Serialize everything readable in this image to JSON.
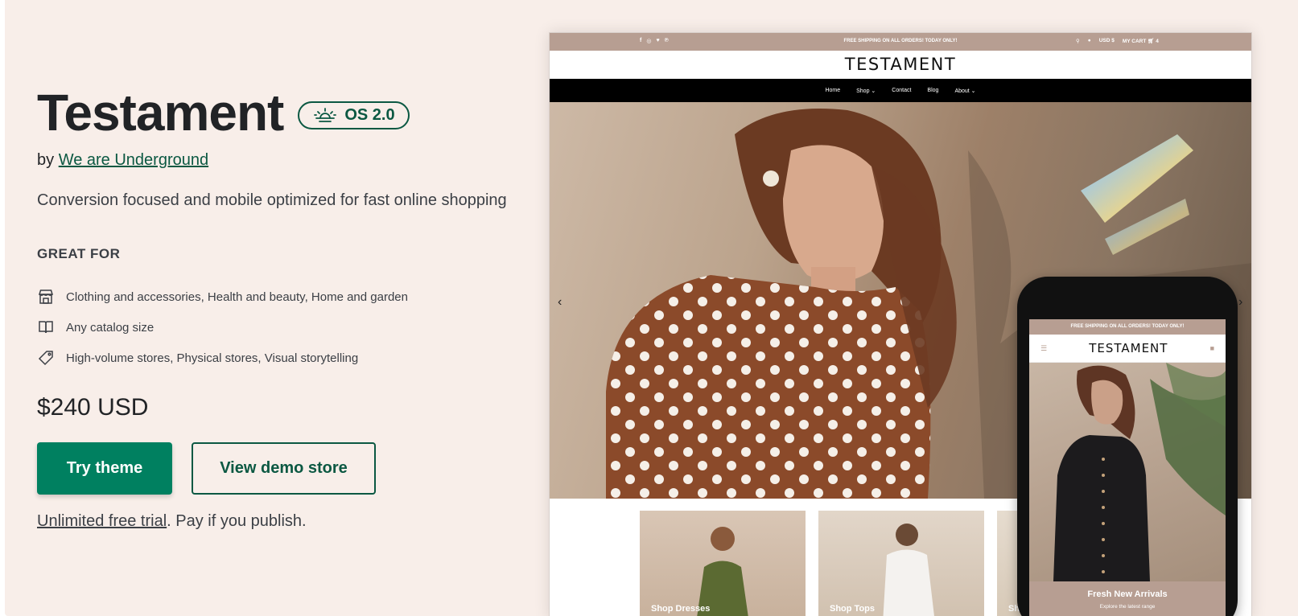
{
  "theme": {
    "name": "Testament",
    "badge": "OS 2.0",
    "by_prefix": "by",
    "author": "We are Underground",
    "tagline": "Conversion focused and mobile optimized for fast online shopping"
  },
  "great_for": {
    "heading": "GREAT FOR",
    "items": [
      {
        "icon": "storefront-icon",
        "label": "Clothing and accessories, Health and beauty, Home and garden"
      },
      {
        "icon": "book-icon",
        "label": "Any catalog size"
      },
      {
        "icon": "tag-icon",
        "label": "High-volume stores, Physical stores, Visual storytelling"
      }
    ]
  },
  "price": "$240 USD",
  "actions": {
    "try_label": "Try theme",
    "demo_label": "View demo store"
  },
  "trial": {
    "link": "Unlimited free trial",
    "rest": ". Pay if you publish."
  },
  "desktop_preview": {
    "social_icons": [
      "f",
      "◎",
      "♥",
      "℗"
    ],
    "announcement": "FREE SHIPPING ON ALL ORDERS! TODAY ONLY!",
    "currency": "USD $",
    "cart": "MY CART",
    "cart_count": "4",
    "logo": "TESTAMENT",
    "nav": [
      "Home",
      "Shop ⌄",
      "Contact",
      "Blog",
      "About ⌄"
    ],
    "cards": [
      "Shop Dresses",
      "Shop Tops",
      "Sh"
    ]
  },
  "mobile_preview": {
    "announcement": "FREE SHIPPING ON ALL ORDERS! TODAY ONLY!",
    "logo": "TESTAMENT",
    "hero_title": "Fresh New Arrivals",
    "hero_sub": "Explore the latest range"
  },
  "colors": {
    "background": "#f8eee9",
    "primary": "#008060",
    "brand_dark": "#0b5842",
    "preview_accent": "#b79e92"
  }
}
